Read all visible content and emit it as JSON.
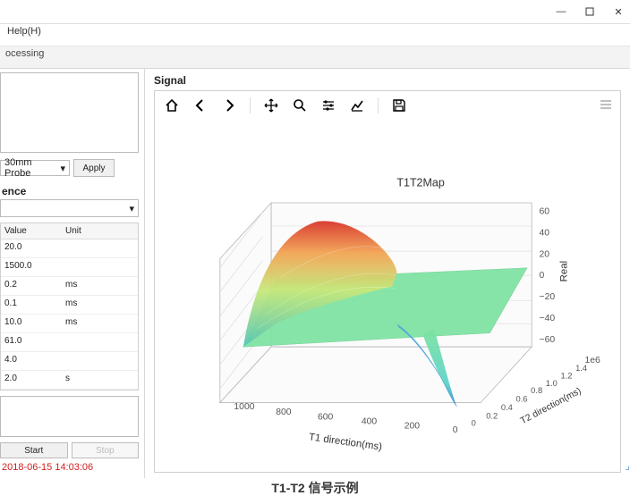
{
  "window": {
    "min": "—",
    "max": "☐",
    "close": "✕"
  },
  "menu": {
    "help": "Help(H)"
  },
  "tabs": {
    "processing": "ocessing"
  },
  "probe": {
    "value": "30mm Probe",
    "apply": "Apply"
  },
  "section": {
    "ence_h": "ence"
  },
  "table": {
    "headers": {
      "value": "Value",
      "unit": "Unit"
    },
    "rows": [
      {
        "value": "20.0",
        "unit": ""
      },
      {
        "value": "1500.0",
        "unit": ""
      },
      {
        "value": "0.2",
        "unit": "ms"
      },
      {
        "value": "0.1",
        "unit": "ms"
      },
      {
        "value": "10.0",
        "unit": "ms"
      },
      {
        "value": "61.0",
        "unit": ""
      },
      {
        "value": "4.0",
        "unit": ""
      },
      {
        "value": "2.0",
        "unit": "s"
      }
    ]
  },
  "buttons": {
    "start": "Start",
    "stop": "Stop"
  },
  "timestamp": "2018-06-15 14:03:06",
  "signal": {
    "header": "Signal"
  },
  "chart_data": {
    "type": "surface3d",
    "title": "T1T2Map",
    "xlabel": "T1 direction(ms)",
    "ylabel": "T2 direction(ms)",
    "zlabel": "Real",
    "x_ticks": [
      0,
      200,
      400,
      600,
      800,
      1000
    ],
    "y_ticks": [
      0,
      0.2,
      0.4,
      0.6,
      0.8,
      1.0,
      1.2,
      1.4
    ],
    "y_exp": "1e6",
    "z_ticks": [
      -60,
      -40,
      -20,
      0,
      20,
      40,
      60
    ],
    "xlim": [
      0,
      1000
    ],
    "ylim": [
      0,
      1400000.0
    ],
    "zlim": [
      -60,
      60
    ],
    "description": "smooth saddle-like surface: high Real (~60, red) at low T1/low T2 corner, dips to ~ -60 (blue) near T1≈0 high-T2 region, flattens toward 0 (green) over most of the T1-T2 plane"
  },
  "caption": "T1-T2 信号示例"
}
